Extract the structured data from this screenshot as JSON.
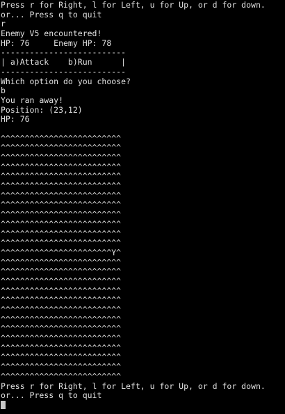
{
  "terminal": {
    "lines": [
      "Press r for Right, l for Left, u for Up, or d for down.",
      "or... Press q to quit",
      "r",
      "Enemy V5 encountered!",
      "HP: 76     Enemy HP: 78",
      "--------------------------",
      "| a)Attack    b)Run      |",
      "--------------------------",
      "Which option do you choose?",
      "b",
      "You ran away!",
      "Position: (23,12)",
      "HP: 76",
      "",
      "^^^^^^^^^^^^^^^^^^^^^^^^^",
      "^^^^^^^^^^^^^^^^^^^^^^^^^",
      "^^^^^^^^^^^^^^^^^^^^^^^^^",
      "^^^^^^^^^^^^^^^^^^^^^^^^^",
      "^^^^^^^^^^^^^^^^^^^^^^^^^",
      "^^^^^^^^^^^^^^^^^^^^^^^^^",
      "^^^^^^^^^^^^^^^^^^^^^^^^^",
      "^^^^^^^^^^^^^^^^^^^^^^^^^",
      "^^^^^^^^^^^^^^^^^^^^^^^^^",
      "^^^^^^^^^^^^^^^^^^^^^^^^^",
      "^^^^^^^^^^^^^^^^^^^^^^^^^",
      "^^^^^^^^^^^^^^^^^^^^^^^^^",
      "^^^^^^^^^^^^^^^^^^^^^^^Y^",
      "^^^^^^^^^^^^^^^^^^^^^^^^^",
      "^^^^^^^^^^^^^^^^^^^^^^^^^",
      "^^^^^^^^^^^^^^^^^^^^^^^^^",
      "^^^^^^^^^^^^^^^^^^^^^^^^^",
      "^^^^^^^^^^^^^^^^^^^^^^^^^",
      "^^^^^^^^^^^^^^^^^^^^^^^^^",
      "^^^^^^^^^^^^^^^^^^^^^^^^^",
      "^^^^^^^^^^^^^^^^^^^^^^^^^",
      "^^^^^^^^^^^^^^^^^^^^^^^^^",
      "^^^^^^^^^^^^^^^^^^^^^^^^^",
      "^^^^^^^^^^^^^^^^^^^^^^^^^",
      "^^^^^^^^^^^^^^^^^^^^^^^^^",
      "^^^^^^^^^^^^^^^^^^^^^^^^^",
      "Press r for Right, l for Left, u for Up, or d for down.",
      "or... Press q to quit"
    ]
  },
  "colors": {
    "background": "#000000",
    "foreground": "#e0e0e0",
    "cursor": "#c8c8c8"
  }
}
